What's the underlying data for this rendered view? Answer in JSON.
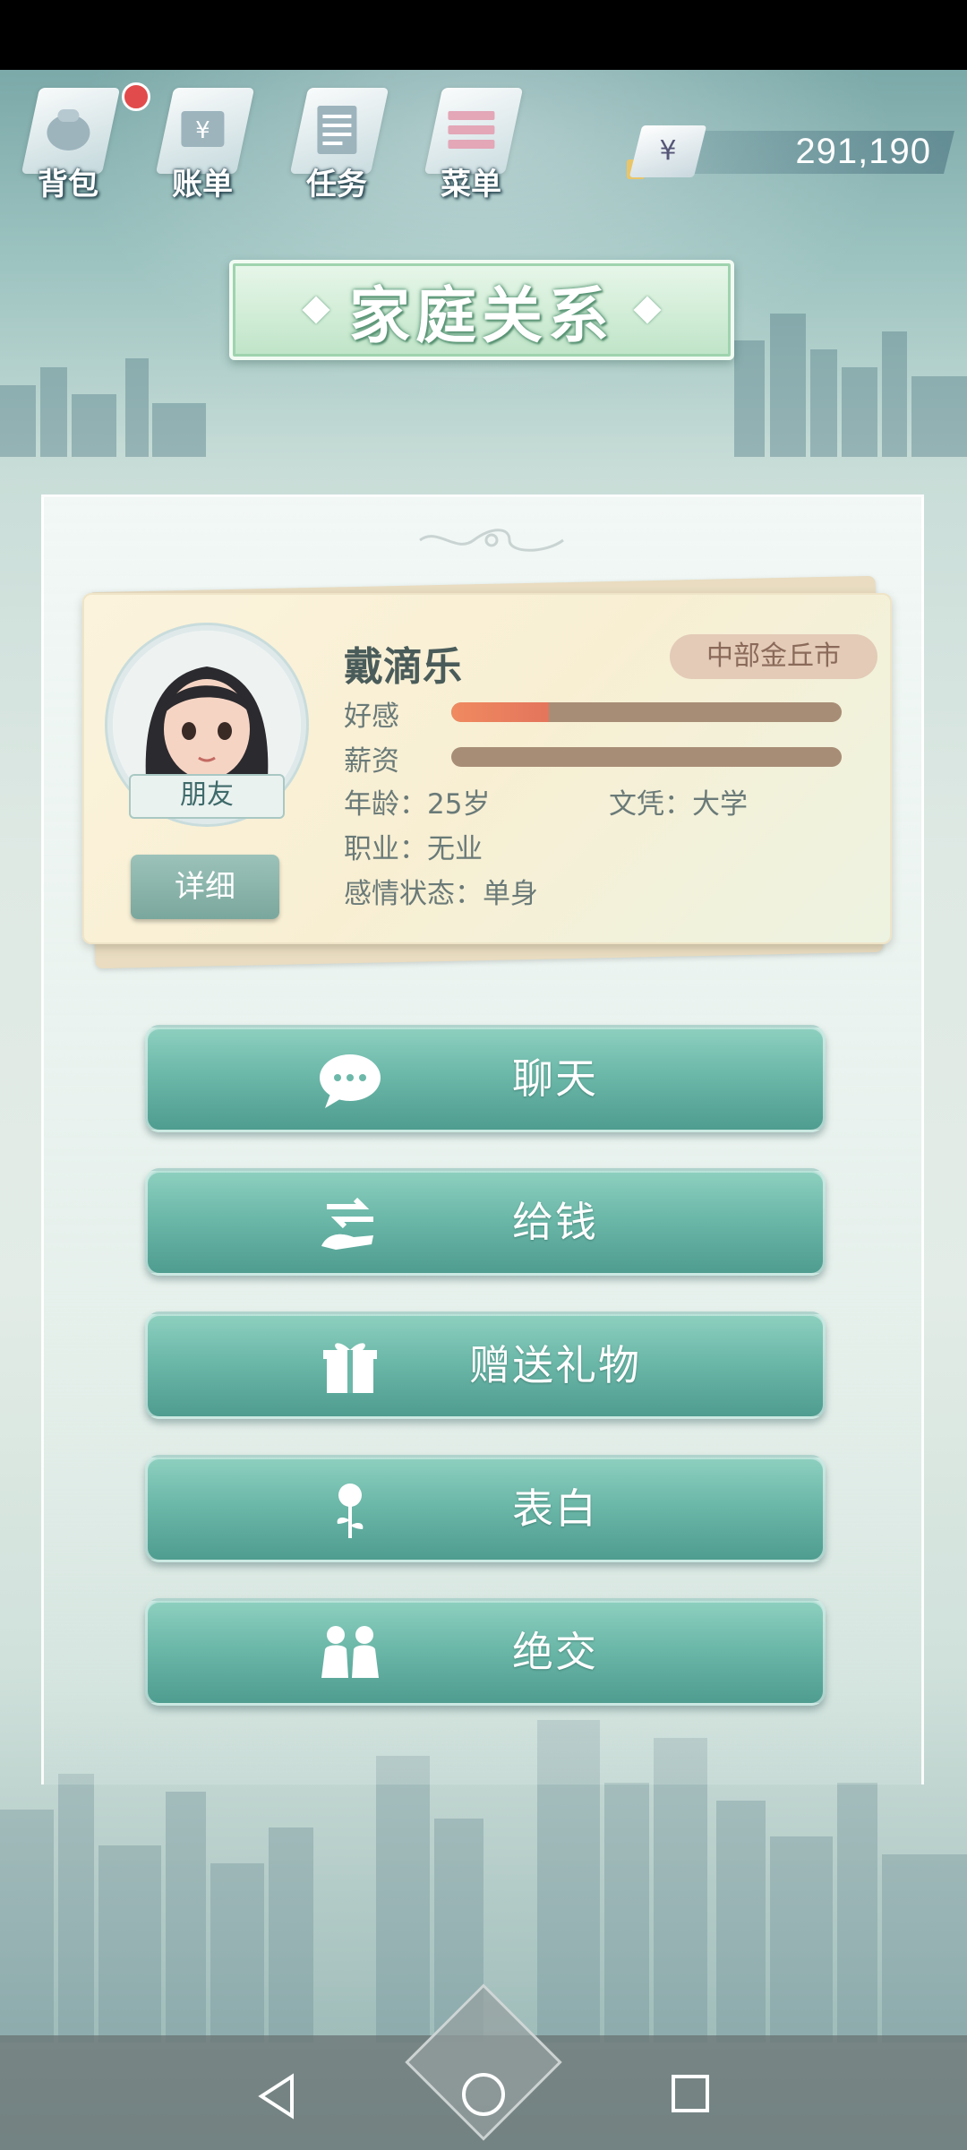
{
  "topnav": {
    "items": [
      {
        "label": "背包",
        "icon": "backpack-icon"
      },
      {
        "label": "账单",
        "icon": "bill-icon"
      },
      {
        "label": "任务",
        "icon": "task-icon"
      },
      {
        "label": "菜单",
        "icon": "menu-icon"
      }
    ],
    "currency_symbol": "¥",
    "money": "291,190"
  },
  "title": "家庭关系",
  "character": {
    "name": "戴滴乐",
    "location": "中部金丘市",
    "relation": "朋友",
    "detail_label": "详细",
    "stats": {
      "affection_label": "好感",
      "affection_level": 0.25,
      "salary_label": "薪资",
      "salary_level": 0.0
    },
    "age": "年龄：25岁",
    "education": "文凭：大学",
    "job": "职业：无业",
    "relationship_status": "感情状态：单身"
  },
  "actions": [
    {
      "label": "聊天",
      "icon": "chat-bubble-icon"
    },
    {
      "label": "给钱",
      "icon": "give-money-icon"
    },
    {
      "label": "赠送礼物",
      "icon": "gift-icon"
    },
    {
      "label": "表白",
      "icon": "rose-icon"
    },
    {
      "label": "绝交",
      "icon": "couple-icon"
    }
  ],
  "colors": {
    "accent": "#6cb8a9",
    "affection_bar": "#e3755c",
    "bar_track": "#a88d76"
  }
}
